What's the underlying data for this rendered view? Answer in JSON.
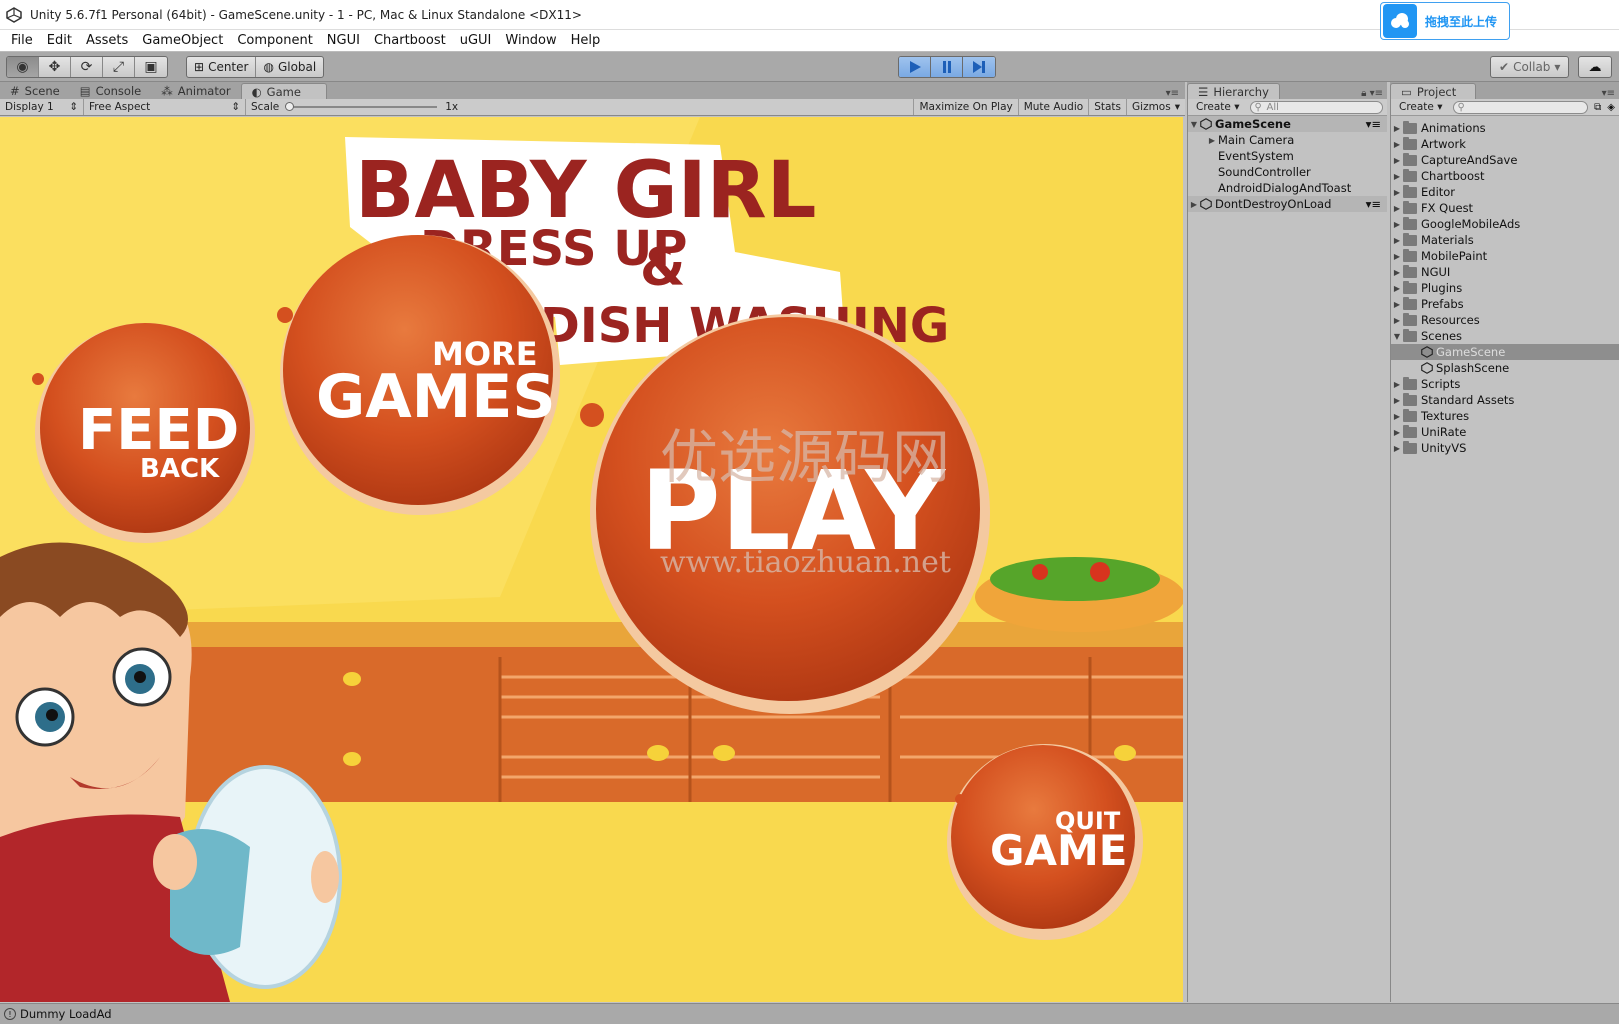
{
  "window": {
    "title": "Unity 5.6.7f1 Personal (64bit) - GameScene.unity - 1 - PC, Mac & Linux Standalone <DX11>",
    "upload_badge": "拖拽至此上传"
  },
  "menu": [
    "File",
    "Edit",
    "Assets",
    "GameObject",
    "Component",
    "NGUI",
    "Chartboost",
    "uGUI",
    "Window",
    "Help"
  ],
  "toolbar": {
    "pivot": "Center",
    "space": "Global",
    "collab": "Collab"
  },
  "tabs": {
    "left": [
      "Scene",
      "Console",
      "Animator",
      "Game"
    ],
    "active": "Game",
    "hierarchy": "Hierarchy",
    "project": "Project"
  },
  "game_toolbar": {
    "display": "Display 1",
    "aspect": "Free Aspect",
    "scale_label": "Scale",
    "scale_value": "1x",
    "maximize": "Maximize On Play",
    "mute": "Mute Audio",
    "stats": "Stats",
    "gizmos": "Gizmos"
  },
  "game": {
    "title_line1": "BABY GIRL",
    "title_line2": "DRESS UP",
    "title_amp": "&",
    "title_line3": "DISH WASHING",
    "feed_back_1": "FEED",
    "feed_back_2": "BACK",
    "more_games_1": "MORE",
    "more_games_2": "GAMES",
    "play": "PLAY",
    "quit_1": "QUIT",
    "quit_2": "GAME",
    "watermark_1": "优选源码网",
    "watermark_2": "www.tiaozhuan.net"
  },
  "hierarchy": {
    "create": "Create",
    "search_placeholder": "All",
    "scene": "GameScene",
    "items": [
      "Main Camera",
      "EventSystem",
      "SoundController",
      "AndroidDialogAndToast"
    ],
    "dont_destroy": "DontDestroyOnLoad"
  },
  "project": {
    "create": "Create",
    "folders_top": [
      "Animations",
      "Artwork",
      "CaptureAndSave",
      "Chartboost",
      "Editor",
      "FX Quest",
      "GoogleMobileAds",
      "Materials",
      "MobilePaint",
      "NGUI",
      "Plugins",
      "Prefabs",
      "Resources",
      "Scenes"
    ],
    "scenes": [
      "GameScene",
      "SplashScene"
    ],
    "folders_bottom": [
      "Scripts",
      "Standard Assets",
      "Textures",
      "UniRate",
      "UnityVS"
    ]
  },
  "status": {
    "message": "Dummy LoadAd"
  },
  "colors": {
    "button_orange": "#d4501f",
    "background_yellow": "#f9d94e",
    "title_red": "#9b2420",
    "play_blue": "#4a8fe0"
  }
}
